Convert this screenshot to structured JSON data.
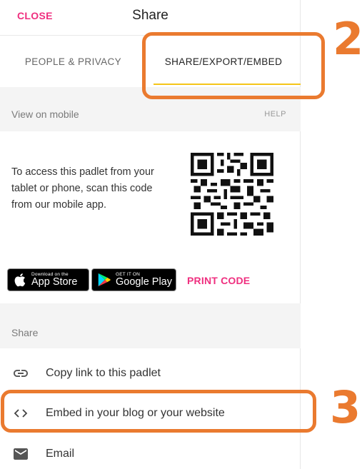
{
  "header": {
    "close_label": "CLOSE",
    "title": "Share"
  },
  "tabs": [
    {
      "label": "PEOPLE & PRIVACY",
      "active": false
    },
    {
      "label": "SHARE/EXPORT/EMBED",
      "active": true
    }
  ],
  "mobile_section": {
    "title": "View on mobile",
    "help_label": "HELP",
    "description": "To access this padlet from your tablet or phone, scan this code from our mobile app.",
    "app_store": {
      "small": "Download on the",
      "big": "App Store"
    },
    "google_play": {
      "small": "GET IT ON",
      "big": "Google Play"
    },
    "print_label": "PRINT CODE"
  },
  "share_section": {
    "title": "Share",
    "items": [
      {
        "icon": "link-icon",
        "label": "Copy link to this padlet"
      },
      {
        "icon": "code-icon",
        "label": "Embed in your blog or your website"
      },
      {
        "icon": "email-icon",
        "label": "Email"
      }
    ]
  },
  "annotations": {
    "step_a": "2",
    "step_b": "3"
  },
  "colors": {
    "accent_pink": "#ef2f7f",
    "tab_underline": "#f5c518",
    "annotation_orange": "#ea7a2f"
  }
}
